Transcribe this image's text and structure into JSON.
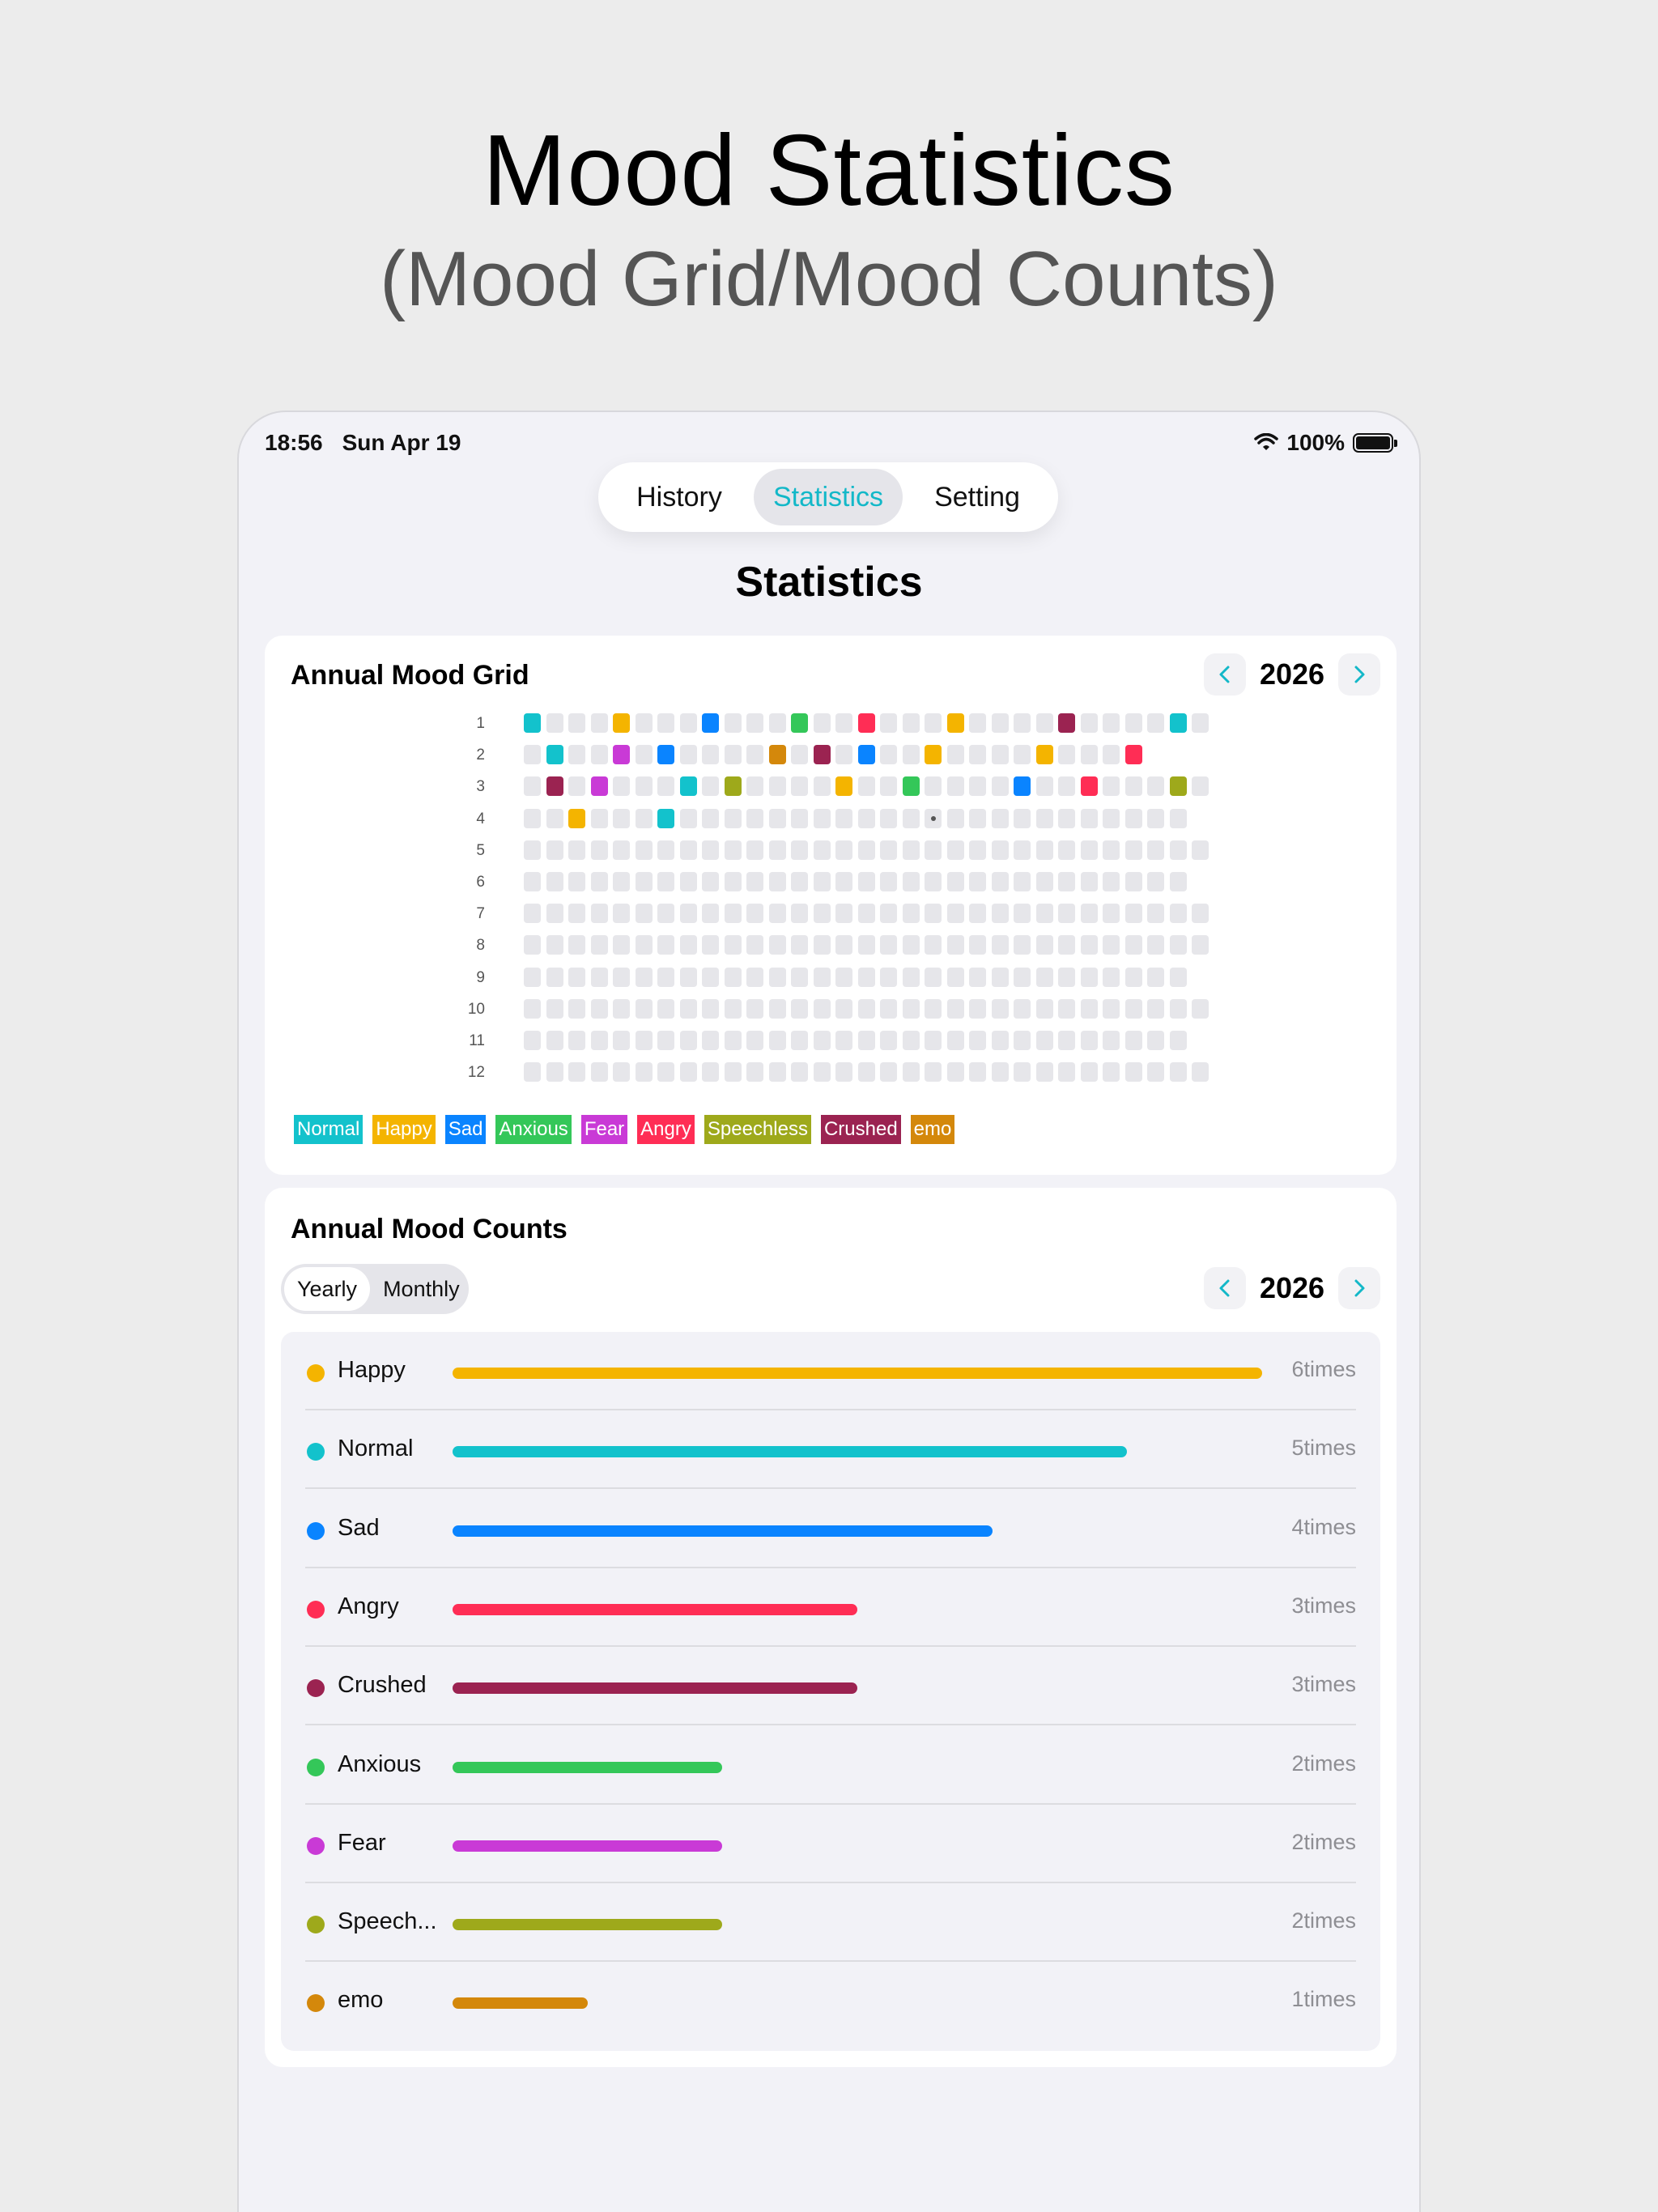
{
  "hero": {
    "title": "Mood Statistics",
    "subtitle": "(Mood Grid/Mood Counts)"
  },
  "status_bar": {
    "time": "18:56",
    "date": "Sun Apr 19",
    "battery": "100%"
  },
  "tabs": [
    {
      "label": "History",
      "active": false
    },
    {
      "label": "Statistics",
      "active": true
    },
    {
      "label": "Setting",
      "active": false
    }
  ],
  "page_title": "Statistics",
  "accent_color": "#13b8c8",
  "moods": {
    "Normal": "#13c2cc",
    "Happy": "#f4b400",
    "Sad": "#0a84ff",
    "Anxious": "#34c759",
    "Fear": "#c93ad6",
    "Angry": "#ff2d55",
    "Speechless": "#9ea91b",
    "Crushed": "#9b2351",
    "emo": "#d4880b"
  },
  "grid_card": {
    "title": "Annual Mood Grid",
    "year": "2026",
    "month_labels": [
      "1",
      "2",
      "3",
      "4",
      "5",
      "6",
      "7",
      "8",
      "9",
      "10",
      "11",
      "12"
    ],
    "days_in_month": [
      31,
      28,
      31,
      30,
      31,
      30,
      31,
      31,
      30,
      31,
      30,
      31
    ],
    "entries": [
      {
        "month": 1,
        "day": 1,
        "mood": "Normal"
      },
      {
        "month": 1,
        "day": 5,
        "mood": "Happy"
      },
      {
        "month": 1,
        "day": 9,
        "mood": "Sad"
      },
      {
        "month": 1,
        "day": 13,
        "mood": "Anxious"
      },
      {
        "month": 1,
        "day": 16,
        "mood": "Angry"
      },
      {
        "month": 1,
        "day": 20,
        "mood": "Happy"
      },
      {
        "month": 1,
        "day": 25,
        "mood": "Crushed"
      },
      {
        "month": 1,
        "day": 30,
        "mood": "Normal"
      },
      {
        "month": 2,
        "day": 2,
        "mood": "Normal"
      },
      {
        "month": 2,
        "day": 5,
        "mood": "Fear"
      },
      {
        "month": 2,
        "day": 7,
        "mood": "Sad"
      },
      {
        "month": 2,
        "day": 12,
        "mood": "emo"
      },
      {
        "month": 2,
        "day": 14,
        "mood": "Crushed"
      },
      {
        "month": 2,
        "day": 16,
        "mood": "Sad"
      },
      {
        "month": 2,
        "day": 19,
        "mood": "Happy"
      },
      {
        "month": 2,
        "day": 24,
        "mood": "Happy"
      },
      {
        "month": 2,
        "day": 28,
        "mood": "Angry"
      },
      {
        "month": 3,
        "day": 2,
        "mood": "Crushed"
      },
      {
        "month": 3,
        "day": 4,
        "mood": "Fear"
      },
      {
        "month": 3,
        "day": 8,
        "mood": "Normal"
      },
      {
        "month": 3,
        "day": 10,
        "mood": "Speechless"
      },
      {
        "month": 3,
        "day": 15,
        "mood": "Happy"
      },
      {
        "month": 3,
        "day": 18,
        "mood": "Anxious"
      },
      {
        "month": 3,
        "day": 23,
        "mood": "Sad"
      },
      {
        "month": 3,
        "day": 26,
        "mood": "Angry"
      },
      {
        "month": 3,
        "day": 30,
        "mood": "Speechless"
      },
      {
        "month": 4,
        "day": 3,
        "mood": "Happy"
      },
      {
        "month": 4,
        "day": 7,
        "mood": "Normal"
      }
    ],
    "today": {
      "month": 4,
      "day": 19
    },
    "legend": [
      "Normal",
      "Happy",
      "Sad",
      "Anxious",
      "Fear",
      "Angry",
      "Speechless",
      "Crushed",
      "emo"
    ]
  },
  "counts_card": {
    "title": "Annual Mood Counts",
    "year": "2026",
    "modes": [
      {
        "label": "Yearly",
        "active": true
      },
      {
        "label": "Monthly",
        "active": false
      }
    ],
    "max_count": 6,
    "rows": [
      {
        "label": "Happy",
        "mood": "Happy",
        "count": 6,
        "times_label": "6times"
      },
      {
        "label": "Normal",
        "mood": "Normal",
        "count": 5,
        "times_label": "5times"
      },
      {
        "label": "Sad",
        "mood": "Sad",
        "count": 4,
        "times_label": "4times"
      },
      {
        "label": "Angry",
        "mood": "Angry",
        "count": 3,
        "times_label": "3times"
      },
      {
        "label": "Crushed",
        "mood": "Crushed",
        "count": 3,
        "times_label": "3times"
      },
      {
        "label": "Anxious",
        "mood": "Anxious",
        "count": 2,
        "times_label": "2times"
      },
      {
        "label": "Fear",
        "mood": "Fear",
        "count": 2,
        "times_label": "2times"
      },
      {
        "label": "Speech...",
        "mood": "Speechless",
        "count": 2,
        "times_label": "2times"
      },
      {
        "label": "emo",
        "mood": "emo",
        "count": 1,
        "times_label": "1times"
      }
    ]
  }
}
